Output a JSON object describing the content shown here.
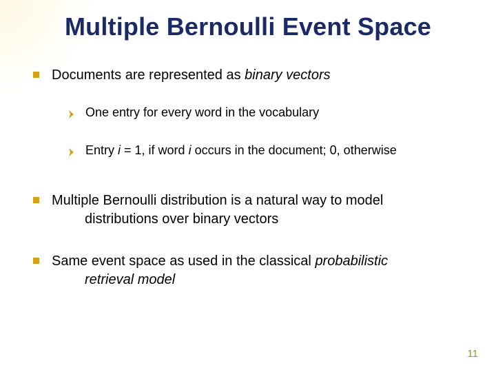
{
  "title": "Multiple Bernoulli Event Space",
  "bullets": {
    "b1": {
      "pre": "Documents are represented as ",
      "em": "binary vectors"
    },
    "b1a": "One entry for every word in the vocabulary",
    "b1b": {
      "t0": "Entry ",
      "i1": "i",
      "t1": " = 1, if word ",
      "i2": "i",
      "t2": " occurs in the document; 0, otherwise"
    },
    "b2": {
      "line1": "Multiple Bernoulli distribution is a natural way to model",
      "line2": "distributions over binary vectors"
    },
    "b3": {
      "line1_pre": "Same event space as used in the classical ",
      "line1_em": "probabilistic",
      "line2_em": "retrieval model"
    }
  },
  "page_number": "11",
  "colors": {
    "title": "#1a2a66",
    "bullet_square": "#d4a017",
    "chevron": "#d4a017",
    "page_num": "#b08b2e"
  }
}
